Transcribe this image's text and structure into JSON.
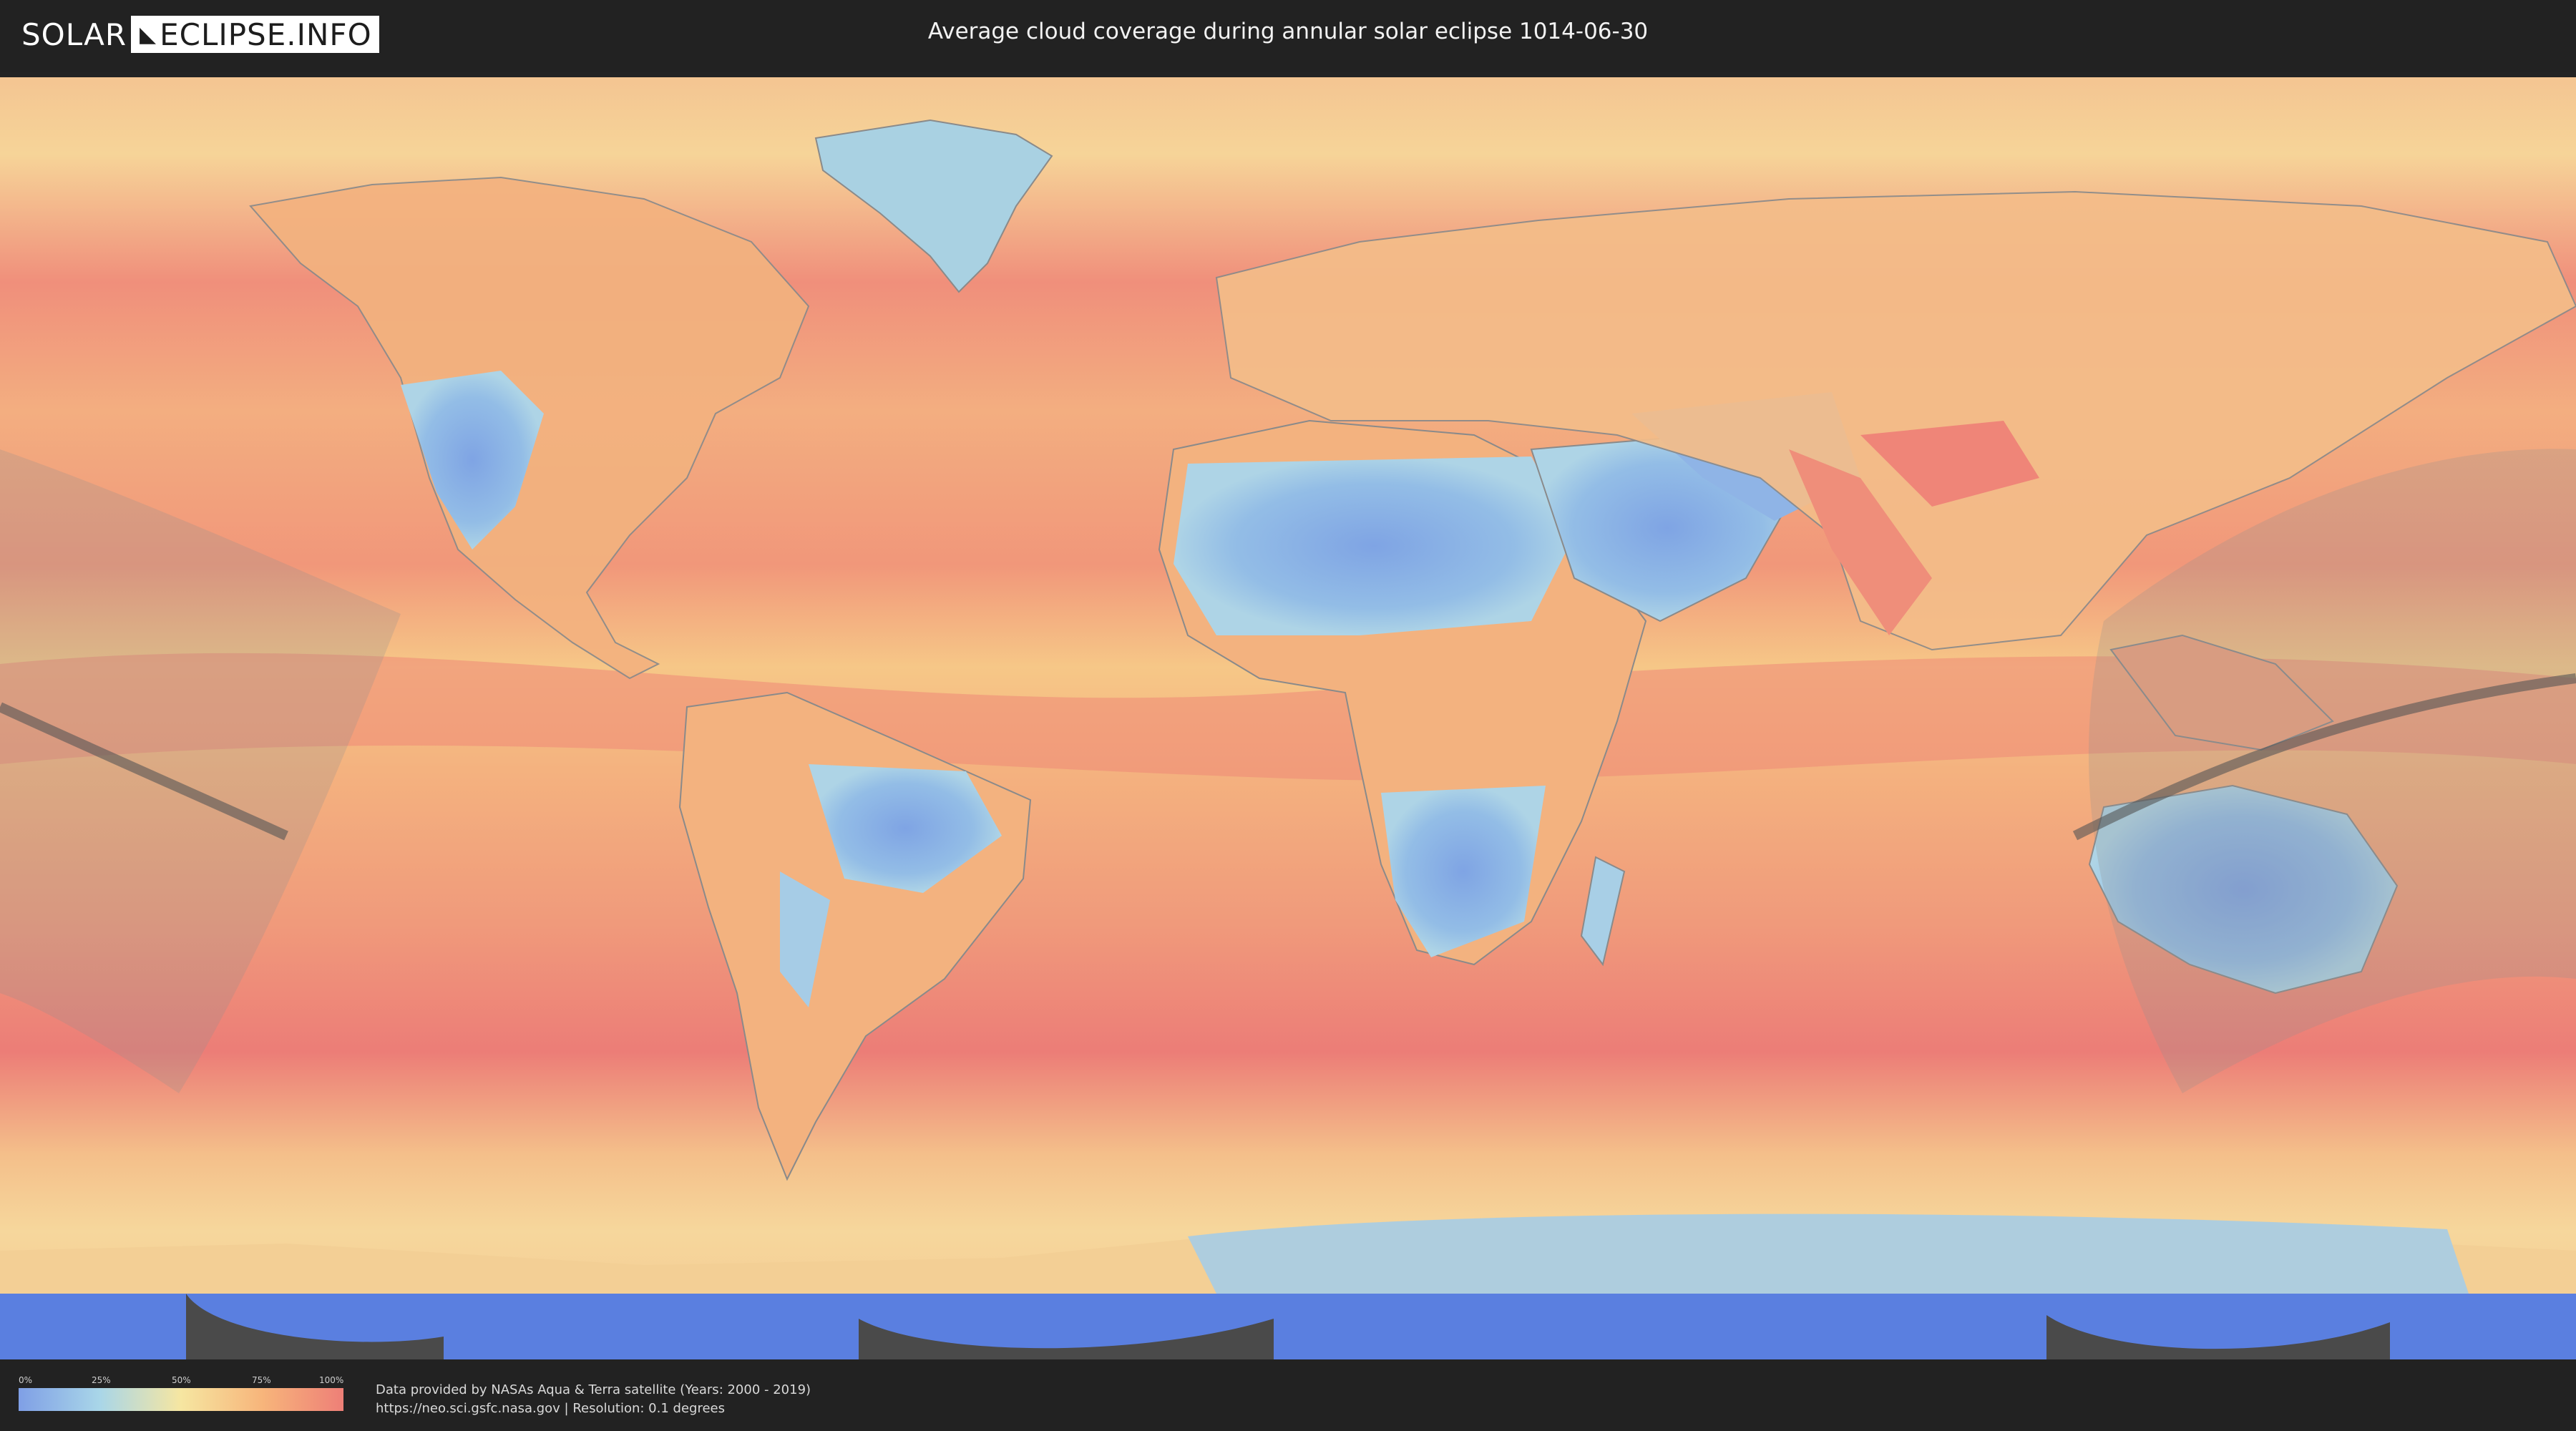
{
  "logo": {
    "left": "SOLAR",
    "right": "ECLIPSE.INFO"
  },
  "title": "Average cloud coverage during annular solar eclipse 1014-06-30",
  "legend": {
    "ticks": [
      "0%",
      "25%",
      "50%",
      "75%",
      "100%"
    ]
  },
  "credits": {
    "line1": "Data provided by NASAs Aqua & Terra satellite (Years: 2000 - 2019)",
    "line2": "https://neo.sci.gsfc.nasa.gov | Resolution: 0.1 degrees"
  },
  "colors": {
    "cloud_0": "#7f9fe6",
    "cloud_25": "#a9d6e8",
    "cloud_50": "#f6e6a1",
    "cloud_75": "#f7b57b",
    "cloud_100": "#ee7f77",
    "eclipse_zone": "#8f8f8f",
    "eclipse_path": "#555555"
  }
}
